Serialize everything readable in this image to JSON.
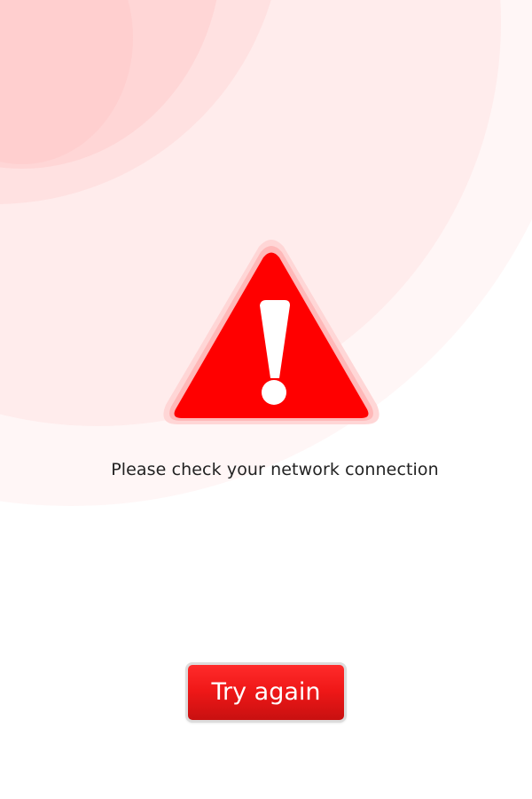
{
  "colors": {
    "accent": "#ff0000",
    "button_top": "#ff2b2b",
    "button_bottom": "#c81010",
    "background_tint": "#ffe4e4",
    "text": "#222222"
  },
  "icon": {
    "name": "warning-triangle-icon"
  },
  "message": "Please check your network connection",
  "retry_button": {
    "label": "Try again"
  }
}
